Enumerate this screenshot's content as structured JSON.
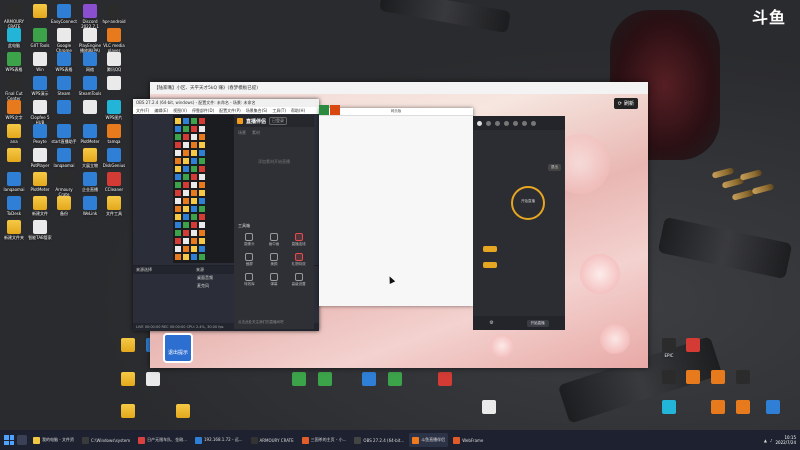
{
  "brand_logo": "斗鱼",
  "desktop_icons_left": [
    {
      "label": "ARMOURY CRATE",
      "style": "app-dark"
    },
    {
      "label": "",
      "style": "folder"
    },
    {
      "label": "EasyConnect",
      "style": "app-blue"
    },
    {
      "label": "Discord 2022.7.1",
      "style": "app-purple"
    },
    {
      "label": "hpr-android",
      "style": "app-dark"
    },
    {
      "label": "此电脑",
      "style": "app-cyan"
    },
    {
      "label": "GIIT Tools",
      "style": "app-green"
    },
    {
      "label": "Google Chrome",
      "style": "app-white"
    },
    {
      "label": "PlayEngine 播放器(PA)",
      "style": "app-white"
    },
    {
      "label": "VLC media player",
      "style": "app-orange"
    },
    {
      "label": "WPS表格",
      "style": "app-green"
    },
    {
      "label": "Win",
      "style": "app-white"
    },
    {
      "label": "WPS表格",
      "style": "app-blue"
    },
    {
      "label": "网络",
      "style": "app-blue"
    },
    {
      "label": "腾讯QQ",
      "style": "app-white"
    },
    {
      "label": "Final Cut Center",
      "style": "app-dark"
    },
    {
      "label": "WPS演示",
      "style": "app-blue"
    },
    {
      "label": "Steam",
      "style": "app-blue"
    },
    {
      "label": "SteamTools",
      "style": "app-blue"
    },
    {
      "label": "",
      "style": "app-white"
    },
    {
      "label": "WPS文字",
      "style": "app-orange"
    },
    {
      "label": "Clopfee 5 HUB",
      "style": "app-white"
    },
    {
      "label": "",
      "style": "app-blue"
    },
    {
      "label": "",
      "style": "app-white"
    },
    {
      "label": "WPS图片",
      "style": "app-cyan"
    },
    {
      "label": "ana",
      "style": "folder"
    },
    {
      "label": "Pexyte",
      "style": "app-blue"
    },
    {
      "label": "start直播助手",
      "style": "app-blue"
    },
    {
      "label": "PlotMeter",
      "style": "app-blue"
    },
    {
      "label": "tamqa",
      "style": "app-orange"
    },
    {
      "label": "",
      "style": "folder"
    },
    {
      "label": "PotPlayer",
      "style": "app-white"
    },
    {
      "label": "lanqaomai",
      "style": "app-blue"
    },
    {
      "label": "大展立物",
      "style": "folder"
    },
    {
      "label": "DiskGenius",
      "style": "app-blue"
    },
    {
      "label": "lanqaomai",
      "style": "app-blue"
    },
    {
      "label": "PlotMeter",
      "style": "folder"
    },
    {
      "label": "Armoury Crate",
      "style": "app-dark"
    },
    {
      "label": "企业直播",
      "style": "app-blue"
    },
    {
      "label": "CCleaner",
      "style": "app-red"
    },
    {
      "label": "ToDesk",
      "style": "app-blue"
    },
    {
      "label": "新建文件",
      "style": "folder"
    },
    {
      "label": "备份",
      "style": "folder"
    },
    {
      "label": "WeLink",
      "style": "app-blue"
    },
    {
      "label": "文件工具",
      "style": "folder"
    },
    {
      "label": "新建文件夹",
      "style": "folder"
    },
    {
      "label": "智能TAB管家",
      "style": "app-white"
    }
  ],
  "desktop_icons_bottom": [
    {
      "label": "",
      "style": "folder"
    },
    {
      "label": "",
      "style": "app-blue"
    },
    {
      "label": "",
      "style": "folder"
    },
    {
      "label": "",
      "style": "app-white"
    },
    {
      "label": "",
      "style": "folder"
    },
    {
      "label": "",
      "style": "folder"
    },
    {
      "label": "",
      "style": "app-green"
    },
    {
      "label": "",
      "style": "app-green"
    },
    {
      "label": "",
      "style": "app-green"
    },
    {
      "label": "",
      "style": "app-blue"
    },
    {
      "label": "",
      "style": "app-red"
    },
    {
      "label": "",
      "style": "app-white"
    }
  ],
  "desktop_icons_right": [
    {
      "label": "EPIC",
      "style": "app-dark"
    },
    {
      "label": "",
      "style": "app-red"
    },
    {
      "label": "",
      "style": "app-dark"
    },
    {
      "label": "",
      "style": "app-orange"
    },
    {
      "label": "",
      "style": "app-orange"
    },
    {
      "label": "",
      "style": "app-dark"
    },
    {
      "label": "",
      "style": "app-cyan"
    },
    {
      "label": "",
      "style": "app-orange"
    },
    {
      "label": "",
      "style": "app-orange"
    },
    {
      "label": "",
      "style": "app-blue"
    }
  ],
  "wall_window": {
    "title": "【陆家嘴】小区、天平天才5kQ 赚》(春梦模板已提)",
    "refresh_label": "刷新"
  },
  "obs": {
    "title": "OBS 27.2.4 (64-bit, windows) - 配置文件: 未命名 - 场景: 未命名",
    "menu": [
      "文件(F)",
      "编辑(E)",
      "视图(V)",
      "停靠部件(D)",
      "配置文件(P)",
      "场景集合(S)",
      "工具(T)",
      "帮助(H)"
    ],
    "scenes_title": "来源选择",
    "sources_title": "来源",
    "sources": [
      "桌面音频",
      "麦克风"
    ],
    "status": "LIVE 00:00:00   REC 00:00:00   CPU: 2.4%, 30.00 fps"
  },
  "assistant": {
    "logo": "直播伴侣",
    "tag": "已登录",
    "tabs": [
      "场景",
      "素材"
    ],
    "empty_text": "添加素材开始直播",
    "section_title": "工具箱",
    "tools": [
      "摄像头",
      "画中画",
      "直播连线",
      "截屏",
      "美颜",
      "礼物特效",
      "特效库",
      "弹幕",
      "高级设置"
    ],
    "footer": "点击此处关注我们的直播间吧"
  },
  "blank_window": {
    "title": "网页版"
  },
  "live": {
    "close_label": "退出",
    "circle_label": "开始直播",
    "start_label": "开始直播"
  },
  "sticker": {
    "label": "退出提示"
  },
  "taskbar": {
    "items": [
      {
        "label": "我的电脑 - 文件资",
        "color": "#f2c744"
      },
      {
        "label": "C:\\Windows\\system",
        "color": "#3a3a3a"
      },
      {
        "label": "日产无限车队、金刚...",
        "color": "#d94040"
      },
      {
        "label": "192.168.1.72 - 远...",
        "color": "#2f7fd6"
      },
      {
        "label": "ARMOURY CRATE",
        "color": "#333"
      },
      {
        "label": "三国杀的主页 - 小...",
        "color": "#e35d2a"
      },
      {
        "label": "OBS 27.2.4 (64-bit...",
        "color": "#444"
      },
      {
        "label": "斗鱼直播伴侣",
        "color": "#f07b1e"
      },
      {
        "label": "WebFrame",
        "color": "#e05a2a"
      }
    ],
    "time": "10:15",
    "date": "2022/7/24"
  }
}
